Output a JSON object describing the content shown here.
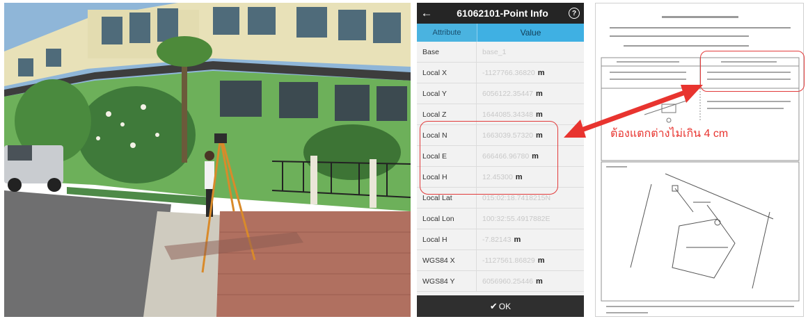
{
  "phone": {
    "title": "61062101-Point Info",
    "col_attribute": "Attribute",
    "col_value": "Value",
    "rows": [
      {
        "attr": "Base",
        "value": "base_1",
        "unit": ""
      },
      {
        "attr": "Local X",
        "value": "-1127766.36820",
        "unit": "m"
      },
      {
        "attr": "Local Y",
        "value": "6056122.35447",
        "unit": "m"
      },
      {
        "attr": "Local Z",
        "value": "1644085.34348",
        "unit": "m"
      },
      {
        "attr": "Local N",
        "value": "1663039.57320",
        "unit": "m"
      },
      {
        "attr": "Local E",
        "value": "666466.96780",
        "unit": "m"
      },
      {
        "attr": "Local H",
        "value": "12.45300",
        "unit": "m"
      },
      {
        "attr": "Local Lat",
        "value": "015:02:18.7418215N",
        "unit": ""
      },
      {
        "attr": "Local Lon",
        "value": "100:32:55.4917882E",
        "unit": ""
      },
      {
        "attr": "Local H",
        "value": "-7.82143",
        "unit": "m"
      },
      {
        "attr": "WGS84 X",
        "value": "-1127561.86829",
        "unit": "m"
      },
      {
        "attr": "WGS84 Y",
        "value": "6056960.25446",
        "unit": "m"
      }
    ],
    "ok_label": "OK"
  },
  "annotation": {
    "text": "ต้องแตกต่างไม่เกิน 4 cm",
    "color": "#e8342f"
  },
  "colors": {
    "accent": "#3fb0e3",
    "highlight": "#e23a3a"
  }
}
